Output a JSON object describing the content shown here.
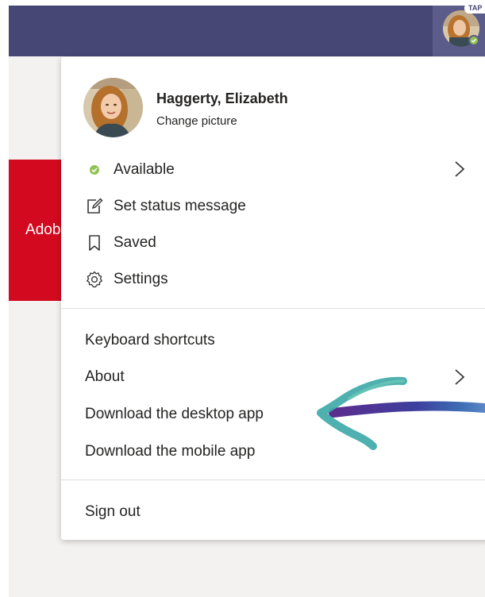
{
  "tile": {
    "text": "Adobe"
  },
  "badge": {
    "text": "TAP"
  },
  "profile": {
    "name": "Haggerty, Elizabeth",
    "change_picture": "Change picture"
  },
  "status_items": [
    {
      "label": "Available",
      "icon": "presence-available-icon"
    },
    {
      "label": "Set status message",
      "icon": "edit-icon"
    },
    {
      "label": "Saved",
      "icon": "bookmark-icon"
    },
    {
      "label": "Settings",
      "icon": "gear-icon"
    }
  ],
  "secondary_items": [
    {
      "label": "Keyboard shortcuts"
    },
    {
      "label": "About"
    },
    {
      "label": "Download the desktop app"
    },
    {
      "label": "Download the mobile app"
    }
  ],
  "sign_out": {
    "label": "Sign out"
  },
  "colors": {
    "topbar": "#464775",
    "available": "#92c353",
    "tile": "#d2091f",
    "arrow_teal": "#3fa9a8",
    "arrow_purple": "#5b2d8e"
  }
}
